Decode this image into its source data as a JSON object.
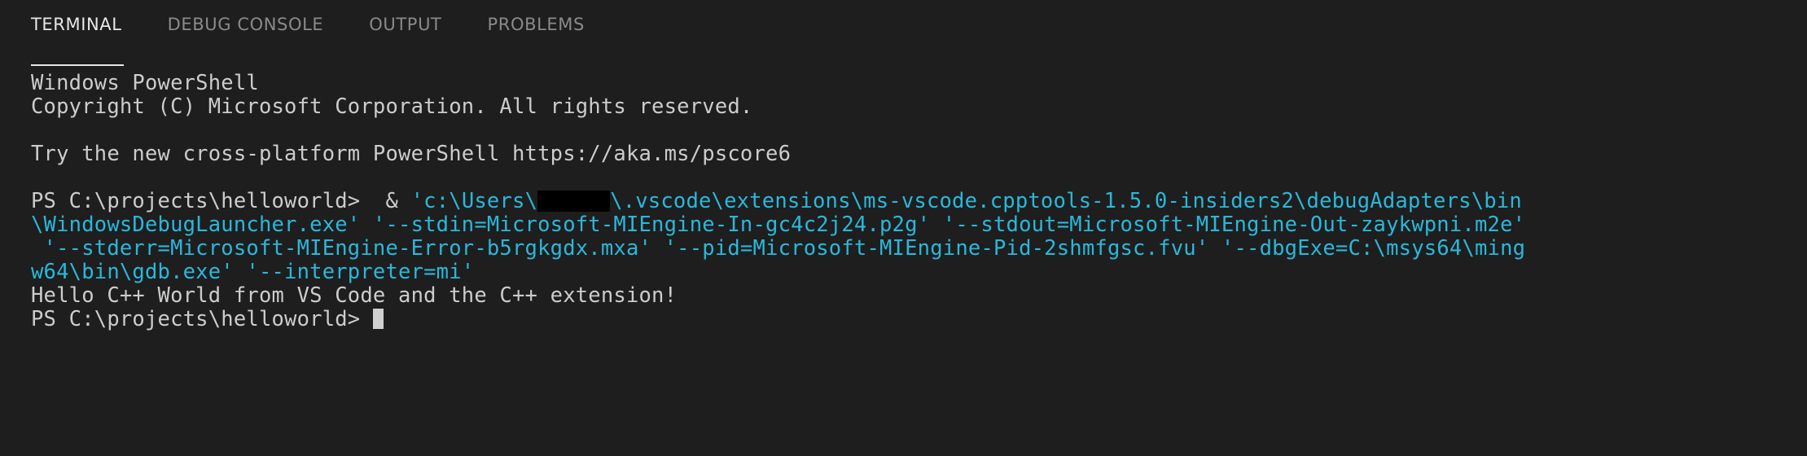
{
  "panel": {
    "background_color": "#1e1e1e",
    "foreground_color": "#cccccc",
    "accent_color": "#29b8db",
    "active_tab_underline_color": "#e7e7e7"
  },
  "tabs": [
    {
      "label": "TERMINAL",
      "active": true
    },
    {
      "label": "DEBUG CONSOLE",
      "active": false
    },
    {
      "label": "OUTPUT",
      "active": false
    },
    {
      "label": "PROBLEMS",
      "active": false
    }
  ],
  "terminal": {
    "lines": [
      {
        "id": "l1",
        "text": "Windows PowerShell"
      },
      {
        "id": "l2",
        "text": "Copyright (C) Microsoft Corporation. All rights reserved."
      },
      {
        "id": "l3",
        "text": ""
      },
      {
        "id": "l4",
        "text": "Try the new cross-platform PowerShell https://aka.ms/pscore6"
      },
      {
        "id": "l5",
        "text": ""
      }
    ],
    "command": {
      "prompt": "PS C:\\projects\\helloworld>",
      "operator": "&",
      "path_prefix": "'c:\\Users\\",
      "redacted_user": "",
      "path_suffix": "\\.vscode\\extensions\\ms-vscode.cpptools-1.5.0-insiders2\\debugAdapters\\bin",
      "wrap_2": "\\WindowsDebugLauncher.exe' '--stdin=Microsoft-MIEngine-In-gc4c2j24.p2g' '--stdout=Microsoft-MIEngine-Out-zaykwpni.m2e'",
      "wrap_3": " '--stderr=Microsoft-MIEngine-Error-b5rgkgdx.mxa' '--pid=Microsoft-MIEngine-Pid-2shmfgsc.fvu' '--dbgExe=C:\\msys64\\ming",
      "wrap_4": "w64\\bin\\gdb.exe' '--interpreter=mi'"
    },
    "output_line": "Hello C++ World from VS Code and the C++ extension!",
    "final_prompt": "PS C:\\projects\\helloworld> "
  }
}
